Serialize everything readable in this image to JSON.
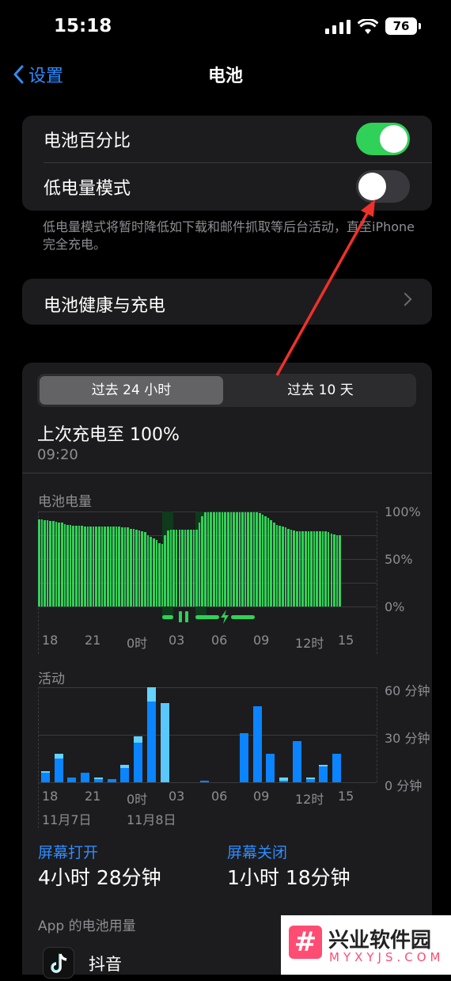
{
  "status": {
    "time": "15:18",
    "battery": "76"
  },
  "nav": {
    "back": "设置",
    "title": "电池"
  },
  "toggles": [
    {
      "label": "电池百分比",
      "on": true
    },
    {
      "label": "低电量模式",
      "on": false
    }
  ],
  "low_power_note": "低电量模式将暂时降低如下载和邮件抓取等后台活动，直至iPhone完全充电。",
  "health_row": "电池健康与充电",
  "segment": {
    "left": "过去 24 小时",
    "right": "过去 10 天",
    "selected": "left"
  },
  "last_charge": {
    "title": "上次充电至 100%",
    "time": "09:20"
  },
  "battery_chart": {
    "label": "电池电量",
    "y_ticks": [
      "100%",
      "50%",
      "0%"
    ],
    "x_ticks": [
      "18",
      "21",
      "0时",
      "03",
      "06",
      "09",
      "12时",
      "15"
    ]
  },
  "activity_chart": {
    "label": "活动",
    "y_ticks": [
      "60 分钟",
      "30 分钟",
      "0 分钟"
    ],
    "x_ticks": [
      "18",
      "21",
      "0时",
      "03",
      "06",
      "09",
      "12时",
      "15"
    ],
    "dates": [
      "11月7日",
      "11月8日"
    ]
  },
  "screen_on": {
    "label": "屏幕打开",
    "value": "4小时 28分钟"
  },
  "screen_off": {
    "label": "屏幕关闭",
    "value": "1小时 18分钟"
  },
  "app_usage_header": "App 的电池用量",
  "app_row": {
    "name": "抖音"
  },
  "watermark": {
    "brand": "兴业软件园",
    "url": "MYXYJS.COM"
  },
  "chart_data": [
    {
      "type": "bar",
      "title": "电池电量",
      "x": [
        "18",
        "21",
        "0时",
        "03",
        "06",
        "09",
        "12时",
        "15"
      ],
      "ylim": [
        0,
        100
      ],
      "values": [
        92,
        92,
        91,
        91,
        90,
        90,
        89,
        88,
        88,
        87,
        86,
        86,
        85,
        85,
        85,
        85,
        84,
        84,
        84,
        84,
        84,
        84,
        84,
        84,
        84,
        84,
        84,
        84,
        84,
        83,
        83,
        83,
        82,
        82,
        81,
        80,
        79,
        78,
        75,
        73,
        72,
        70,
        67,
        66,
        75,
        80,
        81,
        81,
        81,
        81,
        81,
        81,
        81,
        81,
        81,
        81,
        88,
        95,
        99,
        99,
        99,
        99,
        99,
        99,
        99,
        99,
        99,
        99,
        99,
        99,
        99,
        99,
        99,
        99,
        99,
        99,
        99,
        98,
        97,
        95,
        93,
        91,
        88,
        86,
        85,
        84,
        83,
        82,
        81,
        80,
        79,
        79,
        79,
        79,
        79,
        79,
        79,
        79,
        79,
        79,
        79,
        78,
        77,
        76,
        75,
        75
      ],
      "charging": true
    },
    {
      "type": "bar",
      "title": "活动",
      "x": [
        "18",
        "21",
        "0时",
        "03",
        "06",
        "09",
        "12时",
        "15"
      ],
      "ylim": [
        0,
        60
      ],
      "series": [
        {
          "name": "屏幕打开",
          "values": [
            6,
            15,
            3,
            6,
            2,
            2,
            9,
            25,
            51,
            50,
            0,
            0,
            1,
            0,
            0,
            31,
            48,
            18,
            1,
            26,
            2,
            10,
            18
          ]
        },
        {
          "name": "屏幕关闭",
          "values": [
            1,
            3,
            0,
            0,
            1,
            0,
            2,
            4,
            9,
            0,
            0,
            0,
            0,
            0,
            0,
            0,
            0,
            0,
            2,
            0,
            1,
            1,
            0
          ]
        }
      ]
    }
  ]
}
